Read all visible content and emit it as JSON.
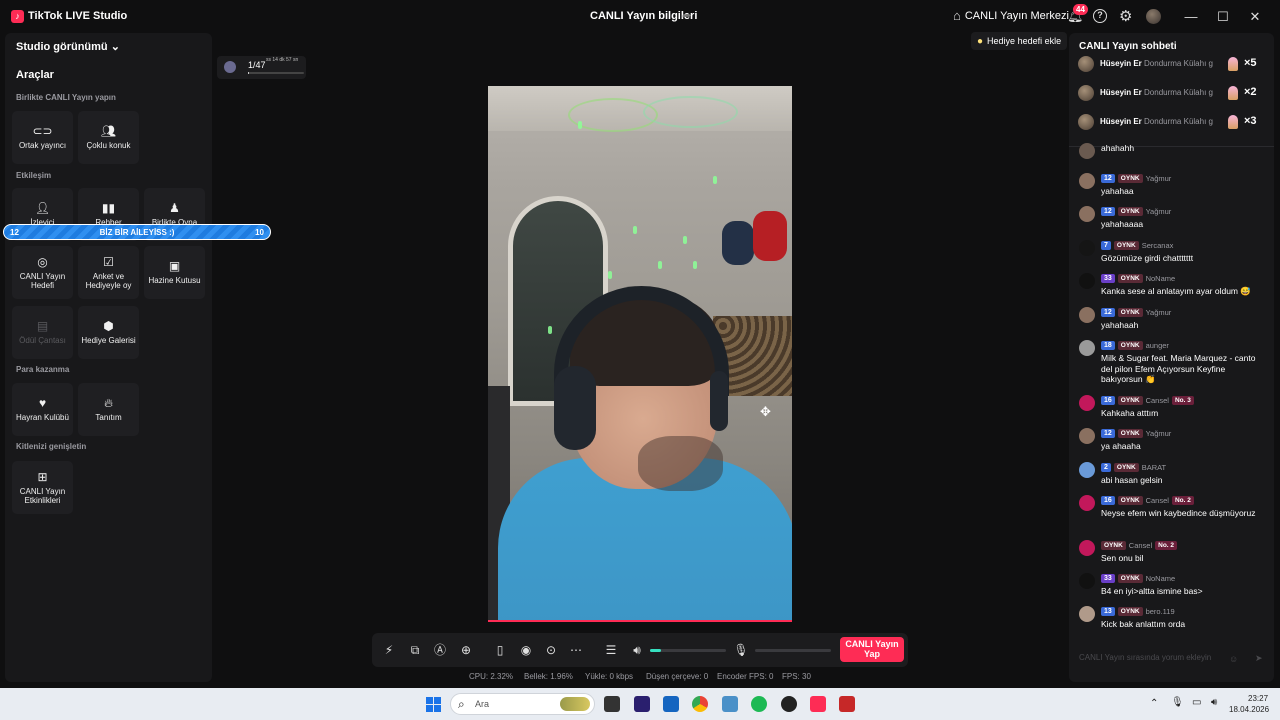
{
  "titlebar": {
    "app_title": "TikTok LIVE Studio",
    "stream_info": "CANLI Yayın bilgileri",
    "center_link": "CANLI Yayın Merkezi",
    "notification_count": "44"
  },
  "left": {
    "studio_view": "Studio görünümü",
    "tools_title": "Araçlar",
    "sections": {
      "together": "Birlikte CANLI Yayın yapın",
      "interaction": "Etkileşim",
      "monetization": "Para kazanma",
      "audience": "Kitlenizi genişletin"
    },
    "tools": {
      "co_host": "Ortak yayıncı",
      "multi_guest": "Çoklu konuk",
      "viewer": "İzleyici",
      "guide": "Rehber",
      "play_together": "Birlikte Oyna",
      "live_goal": "CANLI Yayın Hedefi",
      "poll": "Anket ve Hediyeyle oy",
      "treasure": "Hazine Kutusu",
      "reward_bag": "Ödül Çantası",
      "gift_gallery": "Hediye Galerisi",
      "fan_club": "Hayran Kulübü",
      "promote": "Tanıtım",
      "live_events": "CANLI Yayın Etkinlikleri"
    }
  },
  "team_banner": {
    "left_num": "12",
    "text": "BİZ BİR AİLEYİSS :)",
    "right_num": "10"
  },
  "viewer_counter": {
    "count": "1/47",
    "time": "ss 14 dk 57 sn",
    "progress": 0.02
  },
  "gift_goal": {
    "label": "Hediye hedefi ekle"
  },
  "controls": {
    "go_live": "CANLI Yayın Yap",
    "volume_level": 0.15,
    "mic_level": 0.0
  },
  "stats": {
    "cpu": "CPU: 2.32%",
    "memory": "Bellek: 1.96%",
    "upload": "Yükle: 0 kbps",
    "dropped": "Düşen çerçeve: 0",
    "encoder_fps": "Encoder FPS: 0",
    "fps": "FPS: 30"
  },
  "chat": {
    "title": "CANLI Yayın sohbeti",
    "gifts": [
      {
        "user": "Hüseyin Er",
        "gift": "Dondurma Külahı g",
        "count": "×5"
      },
      {
        "user": "Hüseyin Er",
        "gift": "Dondurma Külahı g",
        "count": "×2"
      },
      {
        "user": "Hüseyin Er",
        "gift": "Dondurma Külahı g",
        "count": "×3"
      }
    ],
    "messages": [
      {
        "level": "",
        "fan": "",
        "user": "",
        "rank": "",
        "text": "ahahahh"
      },
      {
        "level": "12",
        "fan": "OYNK",
        "user": "Yağmur",
        "rank": "",
        "text": "yahahaa"
      },
      {
        "level": "12",
        "fan": "OYNK",
        "user": "Yağmur",
        "rank": "",
        "text": "yahahaaaa"
      },
      {
        "level": "7",
        "fan": "OYNK",
        "user": "Sercanax",
        "rank": "",
        "text": "Gözümüze girdi chattttttt"
      },
      {
        "level": "33",
        "fan": "OYNK",
        "user": "NoName",
        "rank": "",
        "text": "Kanka sese al anlatayım ayar oldum 😅"
      },
      {
        "level": "12",
        "fan": "OYNK",
        "user": "Yağmur",
        "rank": "",
        "text": "yahahaah"
      },
      {
        "level": "18",
        "fan": "OYNK",
        "user": "aunger",
        "rank": "",
        "text": "Milk & Sugar feat. Maria Marquez - canto del pilon Efem Açıyorsun Keyfine bakıyorsun 👏"
      },
      {
        "level": "16",
        "fan": "OYNK",
        "user": "Cansel",
        "rank": "No. 3",
        "text": "Kahkaha atttım"
      },
      {
        "level": "12",
        "fan": "OYNK",
        "user": "Yağmur",
        "rank": "",
        "text": "ya ahaaha"
      },
      {
        "level": "2",
        "fan": "OYNK",
        "user": "BARAT",
        "rank": "",
        "text": "abi hasan gelsin"
      },
      {
        "level": "16",
        "fan": "OYNK",
        "user": "Cansel",
        "rank": "No. 2",
        "text": "Neyse efem win kaybedince düşmüyoruz"
      },
      {
        "level": "",
        "fan": "OYNK",
        "user": "Cansel",
        "rank": "No. 2",
        "text": "Sen onu bil"
      },
      {
        "level": "33",
        "fan": "OYNK",
        "user": "NoName",
        "rank": "",
        "text": "B4 en iyi>altta ismine bas>"
      },
      {
        "level": "13",
        "fan": "OYNK",
        "user": "bero.119",
        "rank": "",
        "text": "Kick bak anlattım orda"
      }
    ],
    "input_placeholder": "CANLI Yayın sırasında yorum ekleyin"
  },
  "taskbar": {
    "search_placeholder": "Ara",
    "time": "23:27",
    "date": "18.04.2026"
  }
}
